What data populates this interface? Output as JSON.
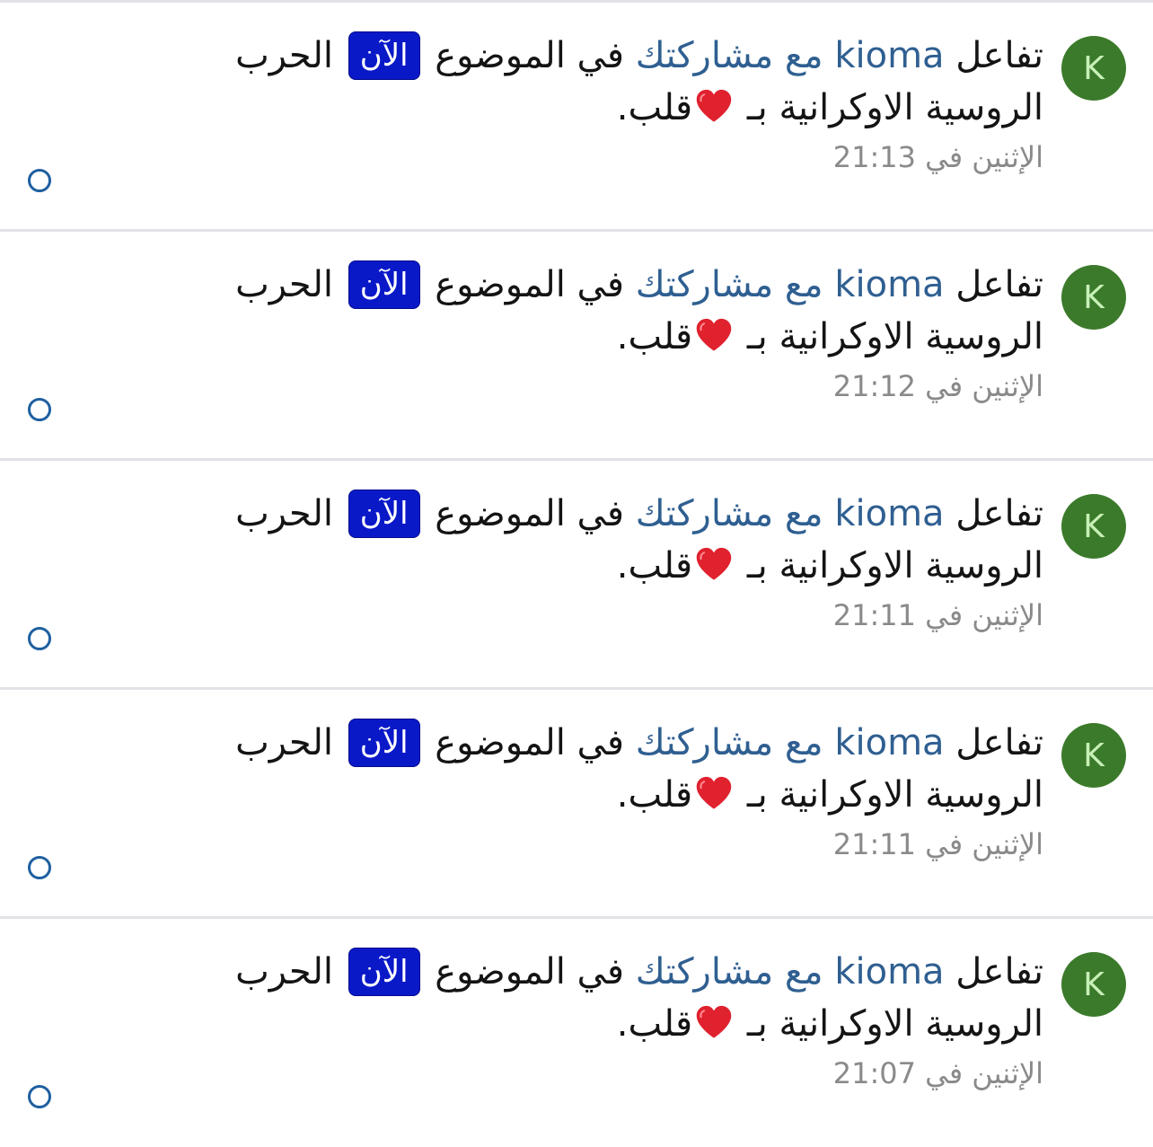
{
  "notifications": [
    {
      "avatar_letter": "K",
      "prefix": "تفاعل",
      "user": "kioma",
      "with": "مع",
      "post_link": "مشاركتك",
      "in_topic": "في الموضوع",
      "badge": "الآن",
      "topic": "الحرب الروسية الاوكرانية",
      "by": "بـ",
      "reaction": "قلب",
      "period": ".",
      "timestamp": "الإثنين في 21:13"
    },
    {
      "avatar_letter": "K",
      "prefix": "تفاعل",
      "user": "kioma",
      "with": "مع",
      "post_link": "مشاركتك",
      "in_topic": "في الموضوع",
      "badge": "الآن",
      "topic": "الحرب الروسية الاوكرانية",
      "by": "بـ",
      "reaction": "قلب",
      "period": ".",
      "timestamp": "الإثنين في 21:12"
    },
    {
      "avatar_letter": "K",
      "prefix": "تفاعل",
      "user": "kioma",
      "with": "مع",
      "post_link": "مشاركتك",
      "in_topic": "في الموضوع",
      "badge": "الآن",
      "topic": "الحرب الروسية الاوكرانية",
      "by": "بـ",
      "reaction": "قلب",
      "period": ".",
      "timestamp": "الإثنين في 21:11"
    },
    {
      "avatar_letter": "K",
      "prefix": "تفاعل",
      "user": "kioma",
      "with": "مع",
      "post_link": "مشاركتك",
      "in_topic": "في الموضوع",
      "badge": "الآن",
      "topic": "الحرب الروسية الاوكرانية",
      "by": "بـ",
      "reaction": "قلب",
      "period": ".",
      "timestamp": "الإثنين في 21:11"
    },
    {
      "avatar_letter": "K",
      "prefix": "تفاعل",
      "user": "kioma",
      "with": "مع",
      "post_link": "مشاركتك",
      "in_topic": "في الموضوع",
      "badge": "الآن",
      "topic": "الحرب الروسية الاوكرانية",
      "by": "بـ",
      "reaction": "قلب",
      "period": ".",
      "timestamp": "الإثنين في 21:07"
    }
  ],
  "colors": {
    "avatar_bg": "#3b7a2a",
    "link": "#2f5f91",
    "badge_bg": "#0a19c8",
    "heart": "#e0212e",
    "timestamp": "#8a8a8a",
    "read_toggle": "#1e5fa0"
  },
  "icons": {
    "reaction_icon": "heart-icon",
    "read_toggle_icon": "circle-outline-icon"
  }
}
